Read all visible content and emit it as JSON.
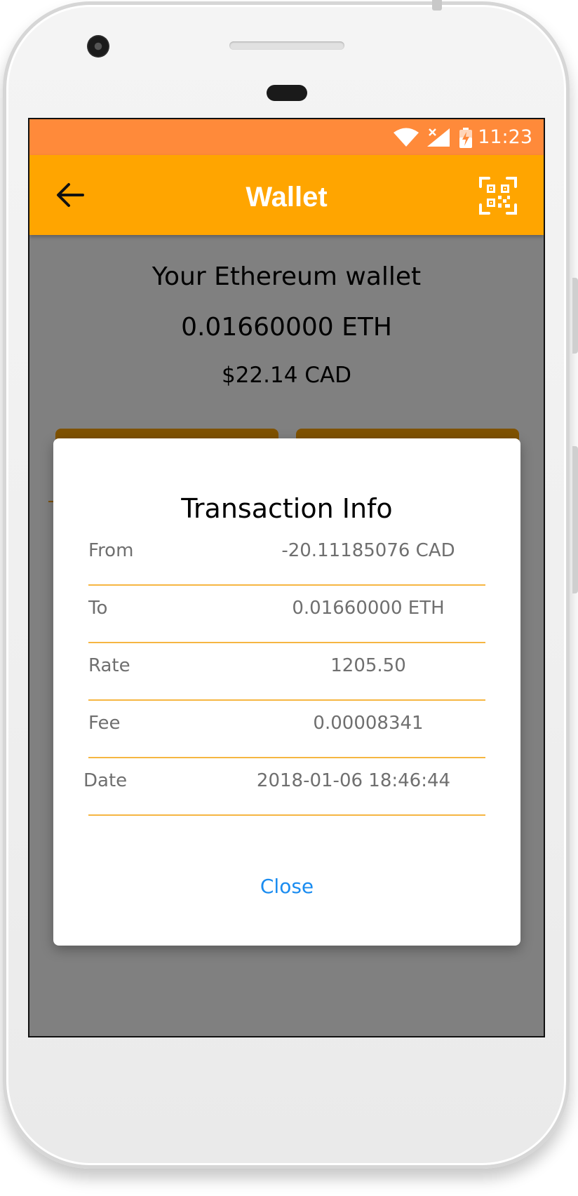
{
  "status_bar": {
    "time": "11:23"
  },
  "app_bar": {
    "title": "Wallet"
  },
  "wallet": {
    "heading": "Your Ethereum wallet",
    "eth_balance": "0.01660000 ETH",
    "cad_balance": "$22.14 CAD"
  },
  "dialog": {
    "title": "Transaction Info",
    "rows": [
      {
        "label": "From",
        "value": "-20.11185076 CAD"
      },
      {
        "label": "To",
        "value": "0.01660000 ETH"
      },
      {
        "label": "Rate",
        "value": "1205.50"
      },
      {
        "label": "Fee",
        "value": "0.00008341"
      },
      {
        "label": "Date",
        "value": "2018-01-06 18:46:44"
      }
    ],
    "close_label": "Close"
  },
  "icons": {
    "back": "arrow-left-icon",
    "qr": "qr-code-icon",
    "wifi": "wifi-icon",
    "signal": "cell-signal-icon",
    "battery": "battery-charging-icon"
  },
  "colors": {
    "status_bar": "#ff8a3a",
    "app_bar": "#ffa500",
    "overlay": "#808080",
    "row_divider": "#f6b642",
    "close_text": "#1a8cf0"
  }
}
